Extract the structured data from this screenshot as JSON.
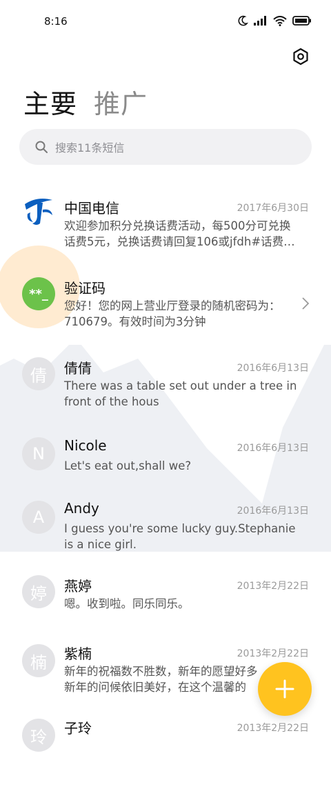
{
  "status_bar": {
    "time": "8:16",
    "icons": [
      "moon-icon",
      "signal-icon",
      "wifi-icon",
      "battery-icon"
    ]
  },
  "header": {
    "tabs": [
      {
        "label": "主要",
        "active": true
      },
      {
        "label": "推广",
        "active": false
      }
    ],
    "settings_icon": "settings-icon"
  },
  "search": {
    "placeholder": "搜索11条短信"
  },
  "messages": [
    {
      "name": "中国电信",
      "date": "2017年6月30日",
      "preview": "欢迎参加积分兑换话费活动，每500分可兑换\n话费5元，兑换话费请回复106或jfdh#话费…",
      "avatar": "china-telecom-logo"
    },
    {
      "name": "验证码",
      "date": "",
      "preview": "您好！您的网上营业厅登录的随机密码为：\n710679。有效时间为3分钟",
      "avatar": "**_"
    },
    {
      "name": "倩倩",
      "date": "2016年6月13日",
      "preview": "There was a table set out under a tree in\nfront of the hous",
      "avatar": "倩"
    },
    {
      "name": "Nicole",
      "date": "2016年6月13日",
      "preview": "Let's eat out,shall we?",
      "avatar": "N"
    },
    {
      "name": "Andy",
      "date": "2016年6月13日",
      "preview": "I guess you're some lucky guy.Stephanie\nis a nice girl.",
      "avatar": "A"
    },
    {
      "name": "燕婷",
      "date": "2013年2月22日",
      "preview": "嗯。收到啦。同乐同乐。",
      "avatar": "婷"
    },
    {
      "name": "紫楠",
      "date": "2013年2月22日",
      "preview": "新年的祝福数不胜数，新年的愿望好多\n新年的问候依旧美好，在这个温馨的",
      "avatar": "楠"
    },
    {
      "name": "子玲",
      "date": "2013年2月22日",
      "preview": "",
      "avatar": "玲"
    }
  ],
  "fab": {
    "icon": "plus-icon",
    "color": "#ffc31f"
  },
  "colors": {
    "accent": "#ffc31f",
    "verify_avatar": "#6cc24a",
    "telecom_blue": "#0b5fbf"
  }
}
